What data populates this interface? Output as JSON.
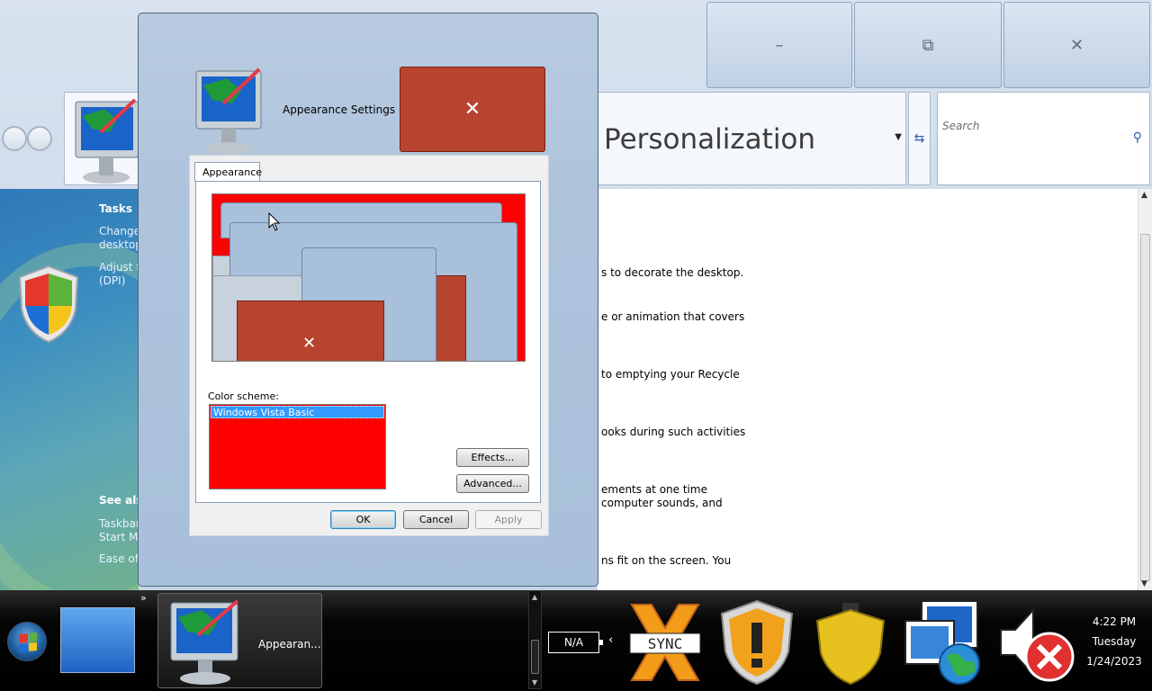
{
  "main_window": {
    "title": "Personalization",
    "search_placeholder": "Search",
    "caption": {
      "minimize": "–",
      "maximize": "⧉",
      "close": "✕"
    },
    "sidebar": {
      "tasks_heading": "Tasks",
      "tasks": [
        "Change\ndesktop",
        "Adjust fo\n(DPI)"
      ],
      "see_also_heading": "See also",
      "see_also": [
        "Taskbar\nStart Me",
        "Ease of A"
      ]
    },
    "content_lines": [
      "s to decorate the desktop.",
      "e or animation that covers",
      "to emptying your Recycle",
      "ooks during such activities",
      "ements at one time\ncomputer sounds, and",
      "ns fit on the screen. You"
    ]
  },
  "dialog": {
    "title": "Appearance Settings",
    "close_glyph": "✕",
    "tab": "Appearance",
    "preview_close_glyph": "✕",
    "color_scheme_label": "Color scheme:",
    "color_scheme_selected": "Windows Vista Basic",
    "buttons": {
      "effects": "Effects...",
      "advanced": "Advanced...",
      "ok": "OK",
      "cancel": "Cancel",
      "apply": "Apply"
    }
  },
  "taskbar": {
    "overflow": "»",
    "active_app_label": "Appearan...",
    "tray_status": "N/A",
    "tray_chevron": "‹",
    "clock": {
      "time": "4:22 PM",
      "day": "Tuesday",
      "date": "1/24/2023"
    }
  },
  "colors": {
    "accent_red": "#b7442f",
    "scheme_red": "#ff0000",
    "selection_blue": "#3399ff"
  }
}
